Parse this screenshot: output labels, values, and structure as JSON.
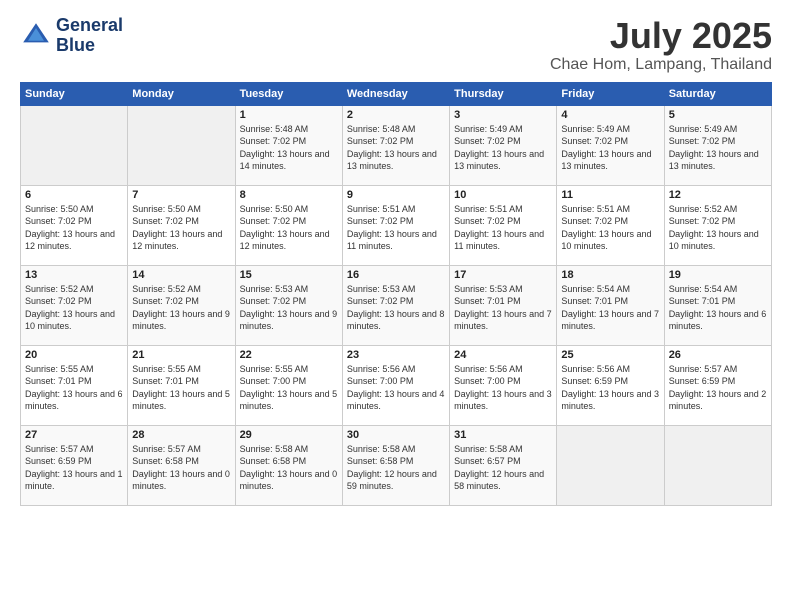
{
  "header": {
    "logo_line1": "General",
    "logo_line2": "Blue",
    "month": "July 2025",
    "location": "Chae Hom, Lampang, Thailand"
  },
  "weekdays": [
    "Sunday",
    "Monday",
    "Tuesday",
    "Wednesday",
    "Thursday",
    "Friday",
    "Saturday"
  ],
  "weeks": [
    [
      {
        "day": "",
        "info": ""
      },
      {
        "day": "",
        "info": ""
      },
      {
        "day": "1",
        "info": "Sunrise: 5:48 AM\nSunset: 7:02 PM\nDaylight: 13 hours\nand 14 minutes."
      },
      {
        "day": "2",
        "info": "Sunrise: 5:48 AM\nSunset: 7:02 PM\nDaylight: 13 hours\nand 13 minutes."
      },
      {
        "day": "3",
        "info": "Sunrise: 5:49 AM\nSunset: 7:02 PM\nDaylight: 13 hours\nand 13 minutes."
      },
      {
        "day": "4",
        "info": "Sunrise: 5:49 AM\nSunset: 7:02 PM\nDaylight: 13 hours\nand 13 minutes."
      },
      {
        "day": "5",
        "info": "Sunrise: 5:49 AM\nSunset: 7:02 PM\nDaylight: 13 hours\nand 13 minutes."
      }
    ],
    [
      {
        "day": "6",
        "info": "Sunrise: 5:50 AM\nSunset: 7:02 PM\nDaylight: 13 hours\nand 12 minutes."
      },
      {
        "day": "7",
        "info": "Sunrise: 5:50 AM\nSunset: 7:02 PM\nDaylight: 13 hours\nand 12 minutes."
      },
      {
        "day": "8",
        "info": "Sunrise: 5:50 AM\nSunset: 7:02 PM\nDaylight: 13 hours\nand 12 minutes."
      },
      {
        "day": "9",
        "info": "Sunrise: 5:51 AM\nSunset: 7:02 PM\nDaylight: 13 hours\nand 11 minutes."
      },
      {
        "day": "10",
        "info": "Sunrise: 5:51 AM\nSunset: 7:02 PM\nDaylight: 13 hours\nand 11 minutes."
      },
      {
        "day": "11",
        "info": "Sunrise: 5:51 AM\nSunset: 7:02 PM\nDaylight: 13 hours\nand 10 minutes."
      },
      {
        "day": "12",
        "info": "Sunrise: 5:52 AM\nSunset: 7:02 PM\nDaylight: 13 hours\nand 10 minutes."
      }
    ],
    [
      {
        "day": "13",
        "info": "Sunrise: 5:52 AM\nSunset: 7:02 PM\nDaylight: 13 hours\nand 10 minutes."
      },
      {
        "day": "14",
        "info": "Sunrise: 5:52 AM\nSunset: 7:02 PM\nDaylight: 13 hours\nand 9 minutes."
      },
      {
        "day": "15",
        "info": "Sunrise: 5:53 AM\nSunset: 7:02 PM\nDaylight: 13 hours\nand 9 minutes."
      },
      {
        "day": "16",
        "info": "Sunrise: 5:53 AM\nSunset: 7:02 PM\nDaylight: 13 hours\nand 8 minutes."
      },
      {
        "day": "17",
        "info": "Sunrise: 5:53 AM\nSunset: 7:01 PM\nDaylight: 13 hours\nand 7 minutes."
      },
      {
        "day": "18",
        "info": "Sunrise: 5:54 AM\nSunset: 7:01 PM\nDaylight: 13 hours\nand 7 minutes."
      },
      {
        "day": "19",
        "info": "Sunrise: 5:54 AM\nSunset: 7:01 PM\nDaylight: 13 hours\nand 6 minutes."
      }
    ],
    [
      {
        "day": "20",
        "info": "Sunrise: 5:55 AM\nSunset: 7:01 PM\nDaylight: 13 hours\nand 6 minutes."
      },
      {
        "day": "21",
        "info": "Sunrise: 5:55 AM\nSunset: 7:01 PM\nDaylight: 13 hours\nand 5 minutes."
      },
      {
        "day": "22",
        "info": "Sunrise: 5:55 AM\nSunset: 7:00 PM\nDaylight: 13 hours\nand 5 minutes."
      },
      {
        "day": "23",
        "info": "Sunrise: 5:56 AM\nSunset: 7:00 PM\nDaylight: 13 hours\nand 4 minutes."
      },
      {
        "day": "24",
        "info": "Sunrise: 5:56 AM\nSunset: 7:00 PM\nDaylight: 13 hours\nand 3 minutes."
      },
      {
        "day": "25",
        "info": "Sunrise: 5:56 AM\nSunset: 6:59 PM\nDaylight: 13 hours\nand 3 minutes."
      },
      {
        "day": "26",
        "info": "Sunrise: 5:57 AM\nSunset: 6:59 PM\nDaylight: 13 hours\nand 2 minutes."
      }
    ],
    [
      {
        "day": "27",
        "info": "Sunrise: 5:57 AM\nSunset: 6:59 PM\nDaylight: 13 hours\nand 1 minute."
      },
      {
        "day": "28",
        "info": "Sunrise: 5:57 AM\nSunset: 6:58 PM\nDaylight: 13 hours\nand 0 minutes."
      },
      {
        "day": "29",
        "info": "Sunrise: 5:58 AM\nSunset: 6:58 PM\nDaylight: 13 hours\nand 0 minutes."
      },
      {
        "day": "30",
        "info": "Sunrise: 5:58 AM\nSunset: 6:58 PM\nDaylight: 12 hours\nand 59 minutes."
      },
      {
        "day": "31",
        "info": "Sunrise: 5:58 AM\nSunset: 6:57 PM\nDaylight: 12 hours\nand 58 minutes."
      },
      {
        "day": "",
        "info": ""
      },
      {
        "day": "",
        "info": ""
      }
    ]
  ]
}
